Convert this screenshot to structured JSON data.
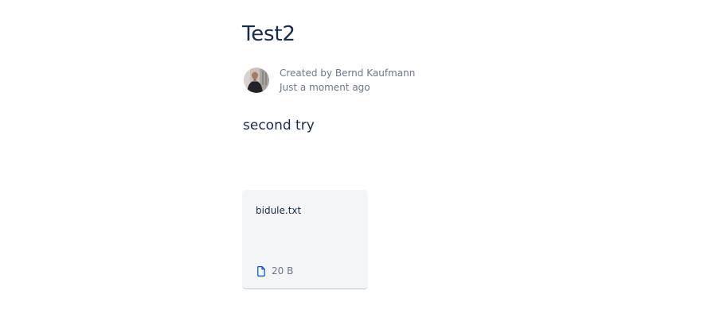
{
  "page": {
    "title": "Test2",
    "body_text": "second try"
  },
  "byline": {
    "created_by": "Created by Bernd Kaufmann",
    "time": "Just a moment ago"
  },
  "attachment": {
    "file_name": "bidule.txt",
    "file_size": "20 B",
    "icon": "document-icon",
    "icon_color": "#0052cc"
  }
}
